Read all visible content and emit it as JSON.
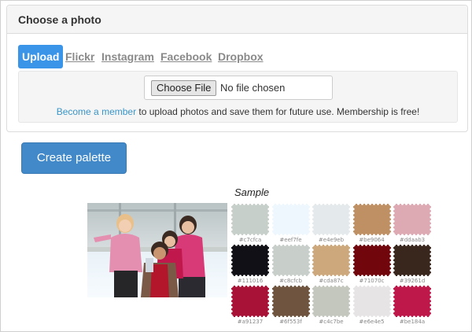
{
  "panel": {
    "title": "Choose a photo",
    "tabs": [
      {
        "label": "Upload"
      },
      {
        "label": "Flickr"
      },
      {
        "label": "Instagram"
      },
      {
        "label": "Facebook"
      },
      {
        "label": "Dropbox"
      }
    ],
    "file_input": {
      "button_label": "Choose File",
      "status": "No file chosen"
    },
    "member_note": {
      "link": "Become a member",
      "text": " to upload photos and save them for future use. Membership is free!"
    }
  },
  "create_button": "Create palette",
  "sample": {
    "title": "Sample",
    "swatches": [
      {
        "hex": "#c7cfca"
      },
      {
        "hex": "#eef7fe"
      },
      {
        "hex": "#e4e9eb"
      },
      {
        "hex": "#be9064"
      },
      {
        "hex": "#ddaab3"
      },
      {
        "hex": "#111016"
      },
      {
        "hex": "#c8cfcb"
      },
      {
        "hex": "#cda87c"
      },
      {
        "hex": "#71070c"
      },
      {
        "hex": "#39261d"
      },
      {
        "hex": "#a91237"
      },
      {
        "hex": "#6f553f"
      },
      {
        "hex": "#c4c7be"
      },
      {
        "hex": "#e6e4e5"
      },
      {
        "hex": "#be184a"
      }
    ]
  }
}
